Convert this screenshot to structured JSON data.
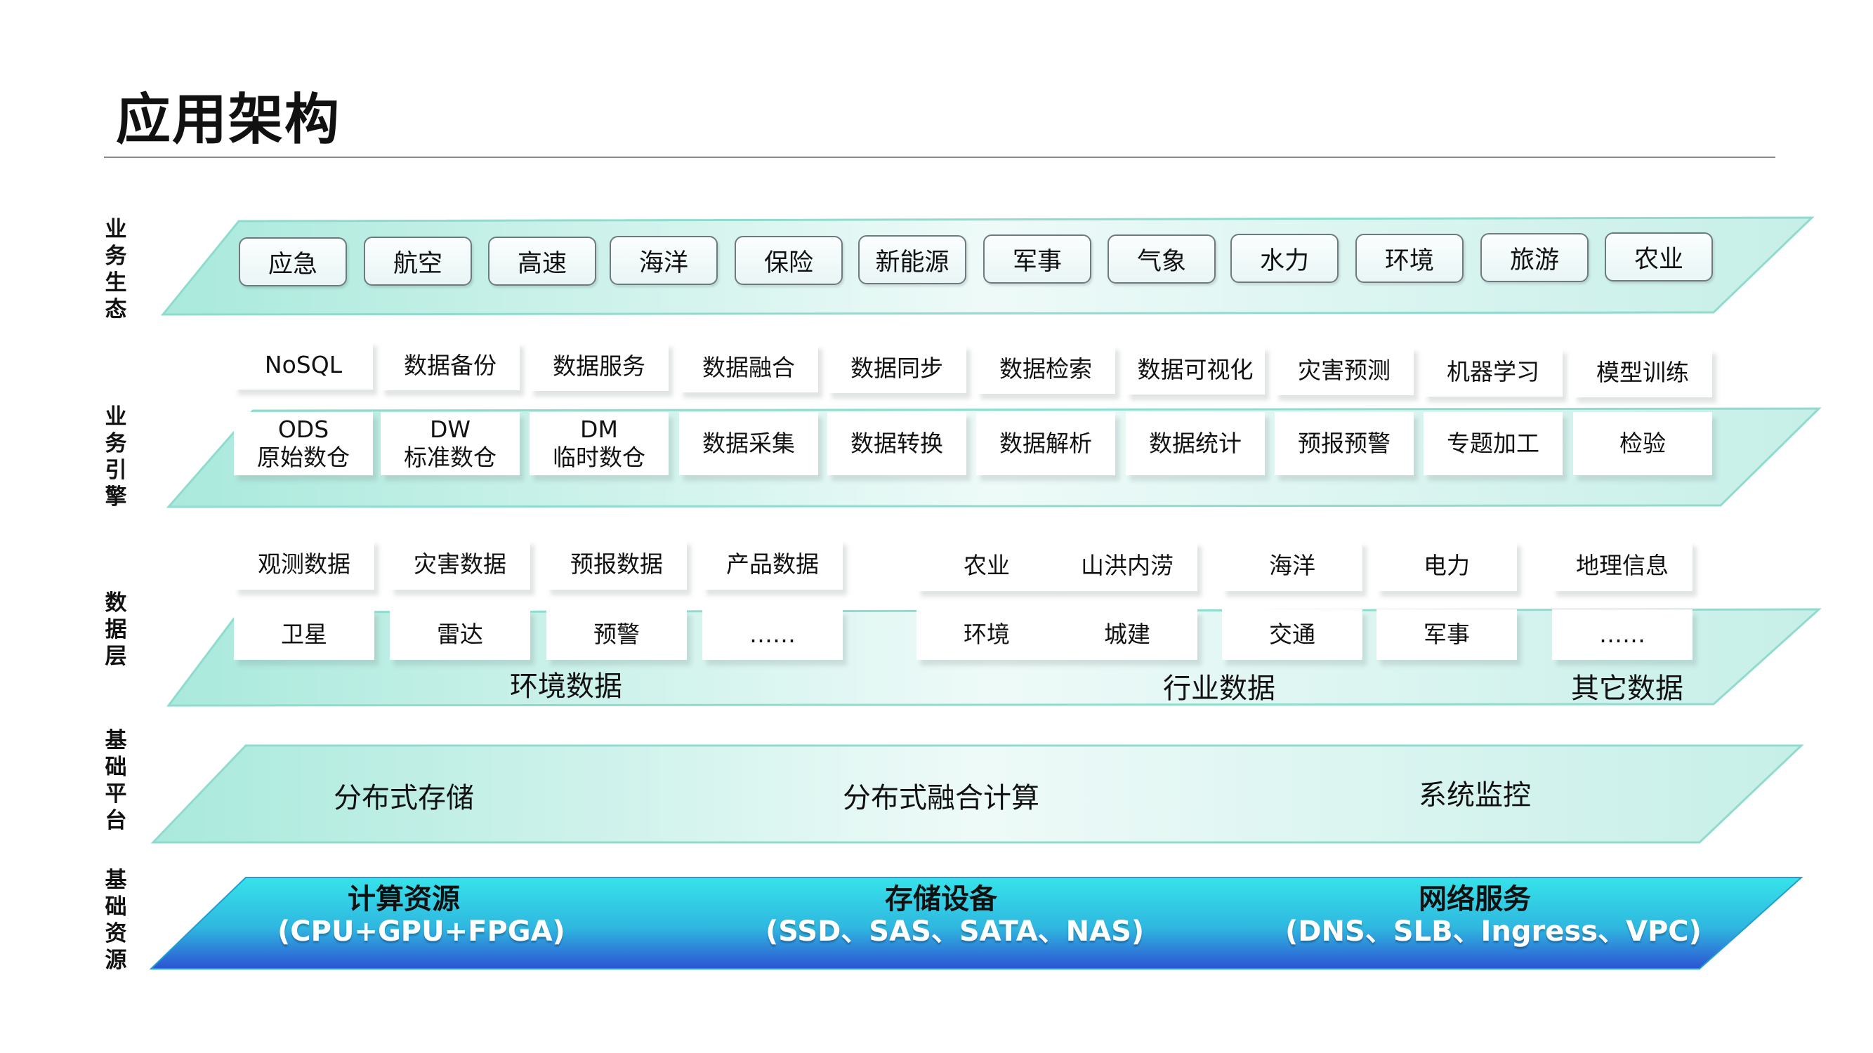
{
  "title": "应用架构",
  "side_labels": {
    "business_ecology": "业务生态",
    "business_engine": "业务引擎",
    "data_layer": "数据层",
    "base_platform": "基础平台",
    "base_resources": "基础资源"
  },
  "ecology": [
    "应急",
    "航空",
    "高速",
    "海洋",
    "保险",
    "新能源",
    "军事",
    "气象",
    "水力",
    "环境",
    "旅游",
    "农业"
  ],
  "engine": {
    "row1": [
      "NoSQL",
      "数据备份",
      "数据服务",
      "数据融合",
      "数据同步",
      "数据检索",
      "数据可视化",
      "灾害预测",
      "机器学习",
      "模型训练"
    ],
    "row2": [
      {
        "line1": "ODS",
        "line2": "原始数仓"
      },
      {
        "line1": "DW",
        "line2": "标准数仓"
      },
      {
        "line1": "DM",
        "line2": "临时数仓"
      },
      {
        "line1": "数据采集",
        "line2": ""
      },
      {
        "line1": "数据转换",
        "line2": ""
      },
      {
        "line1": "数据解析",
        "line2": ""
      },
      {
        "line1": "数据统计",
        "line2": ""
      },
      {
        "line1": "预报预警",
        "line2": ""
      },
      {
        "line1": "专题加工",
        "line2": ""
      },
      {
        "line1": "检验",
        "line2": ""
      }
    ]
  },
  "data_layer": {
    "env_row1": [
      "观测数据",
      "灾害数据",
      "预报数据",
      "产品数据"
    ],
    "env_row2": [
      "卫星",
      "雷达",
      "预警",
      "……"
    ],
    "ind_row1": [
      "农业",
      "山洪内涝",
      "海洋",
      "电力",
      "地理信息"
    ],
    "ind_row2": [
      "环境",
      "城建",
      "交通",
      "军事",
      "……"
    ],
    "env_label": "环境数据",
    "ind_label": "行业数据",
    "other_label": "其它数据"
  },
  "platform": [
    "分布式存储",
    "分布式融合计算",
    "系统监控"
  ],
  "resources": [
    {
      "name": "计算资源",
      "detail": "(CPU+GPU+FPGA)"
    },
    {
      "name": "存储设备",
      "detail": "(SSD、SAS、SATA、NAS)"
    },
    {
      "name": "网络服务",
      "detail": "(DNS、SLB、Ingress、VPC)"
    }
  ],
  "colors": {
    "layer_light": "#bdeee6",
    "layer_edge": "#7fd9c8",
    "resource_top": "#33dde8",
    "resource_bottom": "#2f5fd6"
  }
}
